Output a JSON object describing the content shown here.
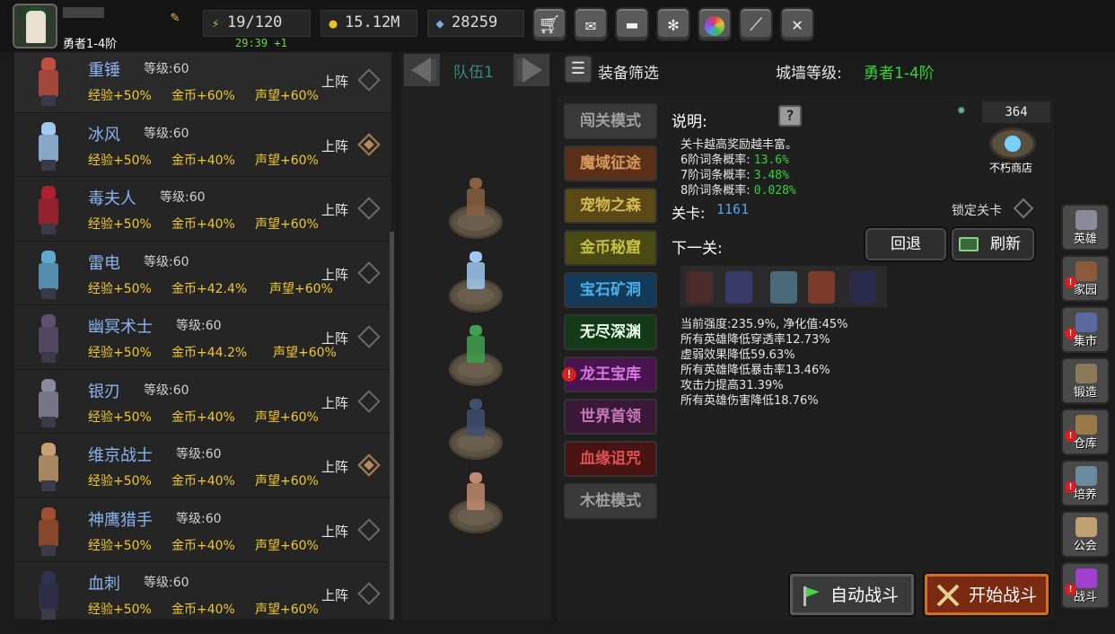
{
  "top_bar": {
    "rank": "勇者1-4阶",
    "energy": "19/120",
    "energy_timer": "29:39 +1",
    "gold": "15.12M",
    "gems": "28259",
    "icons": [
      "shop-cart-icon",
      "mail-icon",
      "gamepad-icon",
      "gear-icon",
      "color-wheel-icon",
      "sword-slash-icon",
      "crossed-swords-icon"
    ]
  },
  "heroes": [
    {
      "name": "重锤",
      "level": "等级:60",
      "exp": "经验+50%",
      "gold": "金币+60%",
      "fame": "声望+60%",
      "deploy": "上阵",
      "selected": false
    },
    {
      "name": "冰风",
      "level": "等级:60",
      "exp": "经验+50%",
      "gold": "金币+40%",
      "fame": "声望+60%",
      "deploy": "上阵",
      "selected": true
    },
    {
      "name": "毒夫人",
      "level": "等级:60",
      "exp": "经验+50%",
      "gold": "金币+40%",
      "fame": "声望+60%",
      "deploy": "上阵",
      "selected": false
    },
    {
      "name": "雷电",
      "level": "等级:60",
      "exp": "经验+50%",
      "gold": "金币+42.4%",
      "fame": "声望+60%",
      "deploy": "上阵",
      "selected": false
    },
    {
      "name": "幽冥术士",
      "level": "等级:60",
      "exp": "经验+50%",
      "gold": "金币+44.2%",
      "fame": "声望+60%",
      "deploy": "上阵",
      "selected": false
    },
    {
      "name": "银刃",
      "level": "等级:60",
      "exp": "经验+50%",
      "gold": "金币+40%",
      "fame": "声望+60%",
      "deploy": "上阵",
      "selected": false
    },
    {
      "name": "维京战士",
      "level": "等级:60",
      "exp": "经验+50%",
      "gold": "金币+40%",
      "fame": "声望+60%",
      "deploy": "上阵",
      "selected": true
    },
    {
      "name": "神鹰猎手",
      "level": "等级:60",
      "exp": "经验+50%",
      "gold": "金币+40%",
      "fame": "声望+60%",
      "deploy": "上阵",
      "selected": false
    },
    {
      "name": "血刺",
      "level": "等级:60",
      "exp": "经验+50%",
      "gold": "金币+40%",
      "fame": "声望+60%",
      "deploy": "上阵",
      "selected": false
    }
  ],
  "team": {
    "label": "队伍1"
  },
  "filter": {
    "label": "装备筛选",
    "wall_label": "城墙等级:",
    "wall_value": "勇者1-4阶"
  },
  "modes": [
    {
      "label": "闯关模式",
      "color": "#3a3a3a",
      "text": "#a0a0a0"
    },
    {
      "label": "魔域征途",
      "color": "#5a3018",
      "text": "#d89a5a"
    },
    {
      "label": "宠物之森",
      "color": "#5a4a18",
      "text": "#d8b850"
    },
    {
      "label": "金币秘窟",
      "color": "#4a4a14",
      "text": "#c8c040"
    },
    {
      "label": "宝石矿洞",
      "color": "#143a5a",
      "text": "#4ab0e8"
    },
    {
      "label": "无尽深渊",
      "color": "#143a18",
      "text": "#e8ffe8"
    },
    {
      "label": "龙王宝库",
      "color": "#4a1450",
      "text": "#d878e0"
    },
    {
      "label": "世界首领",
      "color": "#3a1838",
      "text": "#c878b8"
    },
    {
      "label": "血缘诅咒",
      "color": "#4a1414",
      "text": "#e05050"
    },
    {
      "label": "木桩模式",
      "color": "#3a3a3a",
      "text": "#a0a0a0"
    }
  ],
  "info": {
    "desc_label": "说明:",
    "gem_count": "364",
    "shop_label": "不朽商店",
    "lines": [
      {
        "text": "关卡越高奖励越丰富。",
        "value": ""
      },
      {
        "text": "6阶词条概率:",
        "value": "13.6%"
      },
      {
        "text": "7阶词条概率:",
        "value": "3.48%"
      },
      {
        "text": "8阶词条概率:",
        "value": "0.028%"
      }
    ],
    "stage_label": "关卡:",
    "stage_value": "1161",
    "lock_label": "锁定关卡",
    "next_label": "下一关:",
    "back_label": "回退",
    "refresh_label": "刷新",
    "modifiers": [
      "当前强度:235.9%, 净化值:45%",
      "所有英雄降低穿透率12.73%",
      "虚弱效果降低59.63%",
      "所有英雄降低暴击率13.46%",
      "攻击力提高31.39%",
      "所有英雄伤害降低18.76%"
    ]
  },
  "battle": {
    "auto_label": "自动战斗",
    "start_label": "开始战斗"
  },
  "nav": [
    {
      "label": "英雄",
      "alert": false,
      "color": "#8a8a9a"
    },
    {
      "label": "家园",
      "alert": true,
      "color": "#8a5a3a"
    },
    {
      "label": "集市",
      "alert": true,
      "color": "#5a6aa0"
    },
    {
      "label": "锻造",
      "alert": false,
      "color": "#8a7a5a"
    },
    {
      "label": "仓库",
      "alert": true,
      "color": "#9a7a4a"
    },
    {
      "label": "培养",
      "alert": true,
      "color": "#6a8aa0"
    },
    {
      "label": "公会",
      "alert": false,
      "color": "#c0a070"
    },
    {
      "label": "战斗",
      "alert": true,
      "color": "#a040d0"
    }
  ]
}
